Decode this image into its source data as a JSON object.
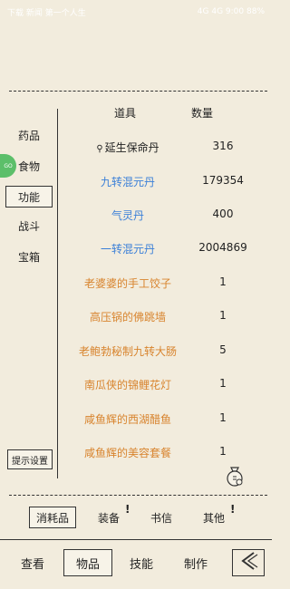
{
  "status_bar": {
    "left_text": "下载 新闻 第一个人生",
    "right_text": "4G 4G 9:00 88%"
  },
  "categories": [
    {
      "label": "药品",
      "selected": false
    },
    {
      "label": "食物",
      "selected": false
    },
    {
      "label": "功能",
      "selected": true
    },
    {
      "label": "战斗",
      "selected": false
    },
    {
      "label": "宝箱",
      "selected": false
    }
  ],
  "badge_text": "GO",
  "settings_button": "提示设置",
  "table": {
    "headers": {
      "name": "道具",
      "qty": "数量"
    },
    "rows": [
      {
        "name": "延生保命丹",
        "qty": "316",
        "color": "black",
        "pinned": true
      },
      {
        "name": "九转混元丹",
        "qty": "179354",
        "color": "blue"
      },
      {
        "name": "气灵丹",
        "qty": "400",
        "color": "blue"
      },
      {
        "name": "一转混元丹",
        "qty": "2004869",
        "color": "blue"
      },
      {
        "name": "老婆婆的手工饺子",
        "qty": "1",
        "color": "orange"
      },
      {
        "name": "高压锅的佛跳墙",
        "qty": "1",
        "color": "orange"
      },
      {
        "name": "老鲍勃秘制九转大肠",
        "qty": "5",
        "color": "orange"
      },
      {
        "name": "南瓜侠的锦鲤花灯",
        "qty": "1",
        "color": "orange"
      },
      {
        "name": "咸鱼辉的西湖醋鱼",
        "qty": "1",
        "color": "orange"
      },
      {
        "name": "咸鱼辉的美容套餐",
        "qty": "1",
        "color": "orange"
      }
    ]
  },
  "subtabs": [
    {
      "label": "消耗品",
      "selected": true
    },
    {
      "label": "装备",
      "selected": false,
      "alert": true
    },
    {
      "label": "书信",
      "selected": false
    },
    {
      "label": "其他",
      "selected": false,
      "alert": true
    }
  ],
  "bottom_tabs": [
    {
      "label": "查看",
      "selected": false
    },
    {
      "label": "物品",
      "selected": true
    },
    {
      "label": "技能",
      "selected": false
    },
    {
      "label": "制作",
      "selected": false
    }
  ],
  "alert_mark": "!",
  "pin_symbol": "⚲",
  "colors": {
    "background": "#f2ecdd",
    "blue": "#3a7fd8",
    "orange": "#d8842e",
    "green_badge": "#5cbf6a"
  },
  "icons": {
    "pin": "pin-icon",
    "bag": "item-bag-icon",
    "back": "back-arrow-icon"
  }
}
